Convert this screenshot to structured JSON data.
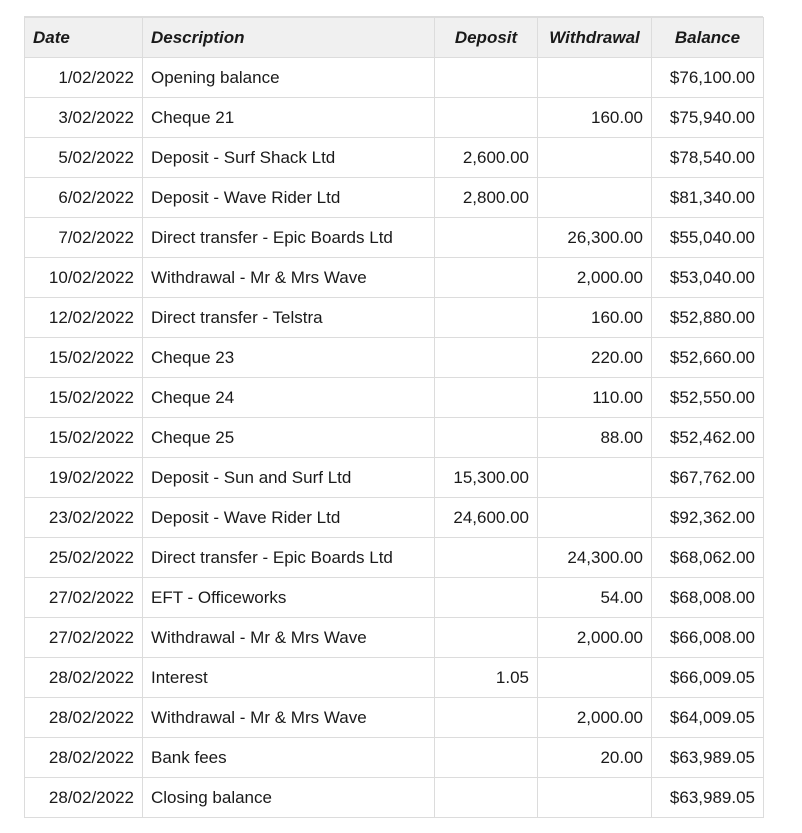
{
  "table": {
    "headers": {
      "date": "Date",
      "description": "Description",
      "deposit": "Deposit",
      "withdrawal": "Withdrawal",
      "balance": "Balance"
    },
    "rows": [
      {
        "date": "1/02/2022",
        "description": "Opening balance",
        "deposit": "",
        "withdrawal": "",
        "balance": "$76,100.00"
      },
      {
        "date": "3/02/2022",
        "description": "Cheque 21",
        "deposit": "",
        "withdrawal": "160.00",
        "balance": "$75,940.00"
      },
      {
        "date": "5/02/2022",
        "description": "Deposit - Surf Shack Ltd",
        "deposit": "2,600.00",
        "withdrawal": "",
        "balance": "$78,540.00"
      },
      {
        "date": "6/02/2022",
        "description": "Deposit - Wave Rider Ltd",
        "deposit": "2,800.00",
        "withdrawal": "",
        "balance": "$81,340.00"
      },
      {
        "date": "7/02/2022",
        "description": "Direct transfer - Epic Boards Ltd",
        "deposit": "",
        "withdrawal": "26,300.00",
        "balance": "$55,040.00"
      },
      {
        "date": "10/02/2022",
        "description": "Withdrawal - Mr & Mrs Wave",
        "deposit": "",
        "withdrawal": "2,000.00",
        "balance": "$53,040.00"
      },
      {
        "date": "12/02/2022",
        "description": "Direct transfer - Telstra",
        "deposit": "",
        "withdrawal": "160.00",
        "balance": "$52,880.00"
      },
      {
        "date": "15/02/2022",
        "description": "Cheque 23",
        "deposit": "",
        "withdrawal": "220.00",
        "balance": "$52,660.00"
      },
      {
        "date": "15/02/2022",
        "description": "Cheque 24",
        "deposit": "",
        "withdrawal": "110.00",
        "balance": "$52,550.00"
      },
      {
        "date": "15/02/2022",
        "description": "Cheque 25",
        "deposit": "",
        "withdrawal": "88.00",
        "balance": "$52,462.00"
      },
      {
        "date": "19/02/2022",
        "description": "Deposit - Sun and Surf Ltd",
        "deposit": "15,300.00",
        "withdrawal": "",
        "balance": "$67,762.00"
      },
      {
        "date": "23/02/2022",
        "description": "Deposit - Wave Rider Ltd",
        "deposit": "24,600.00",
        "withdrawal": "",
        "balance": "$92,362.00"
      },
      {
        "date": "25/02/2022",
        "description": "Direct transfer - Epic Boards Ltd",
        "deposit": "",
        "withdrawal": "24,300.00",
        "balance": "$68,062.00"
      },
      {
        "date": "27/02/2022",
        "description": "EFT - Officeworks",
        "deposit": "",
        "withdrawal": "54.00",
        "balance": "$68,008.00"
      },
      {
        "date": "27/02/2022",
        "description": "Withdrawal - Mr & Mrs Wave",
        "deposit": "",
        "withdrawal": "2,000.00",
        "balance": "$66,008.00"
      },
      {
        "date": "28/02/2022",
        "description": "Interest",
        "deposit": "1.05",
        "withdrawal": "",
        "balance": "$66,009.05"
      },
      {
        "date": "28/02/2022",
        "description": "Withdrawal - Mr & Mrs Wave",
        "deposit": "",
        "withdrawal": "2,000.00",
        "balance": "$64,009.05"
      },
      {
        "date": "28/02/2022",
        "description": "Bank fees",
        "deposit": "",
        "withdrawal": "20.00",
        "balance": "$63,989.05"
      },
      {
        "date": "28/02/2022",
        "description": "Closing balance",
        "deposit": "",
        "withdrawal": "",
        "balance": "$63,989.05"
      }
    ]
  },
  "colors": {
    "header_bg": "#f0f0f0",
    "border": "#dcdcdc",
    "text": "#1a1a1a"
  }
}
